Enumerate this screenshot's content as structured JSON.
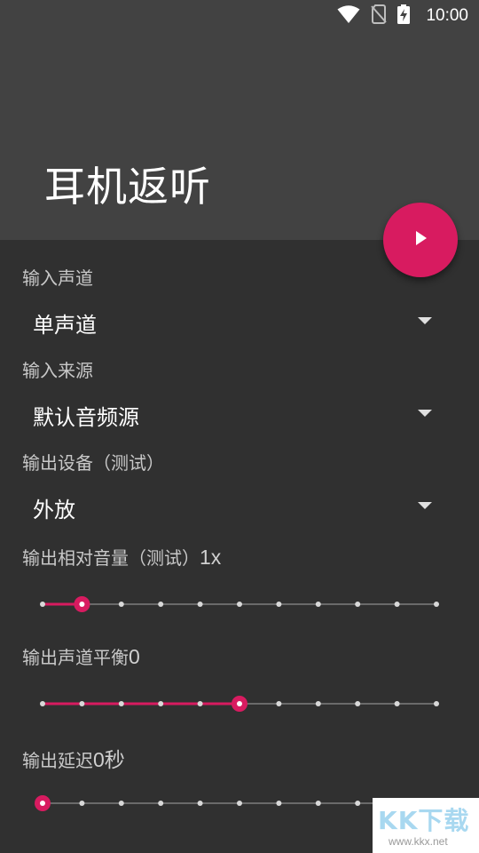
{
  "status_bar": {
    "time": "10:00",
    "icons": [
      "wifi-icon",
      "no-sim-icon",
      "battery-charging-icon"
    ]
  },
  "app": {
    "title": "耳机返听"
  },
  "fab": {
    "icon": "play-icon",
    "color": "#d81b60"
  },
  "settings": {
    "input_channel": {
      "label": "输入声道",
      "value": "单声道"
    },
    "input_source": {
      "label": "输入来源",
      "value": "默认音频源"
    },
    "output_device": {
      "label": "输出设备（测试）",
      "value": "外放"
    },
    "output_volume": {
      "label": "输出相对音量（测试）",
      "value": "1x",
      "steps": 11,
      "position": 1
    },
    "output_balance": {
      "label": "输出声道平衡",
      "value": "0",
      "steps": 11,
      "position": 5
    },
    "output_delay": {
      "label": "输出延迟",
      "value": "0秒",
      "steps": 11,
      "position": 0
    }
  },
  "watermark": {
    "logo": "KK下载",
    "url": "www.kkx.net"
  },
  "colors": {
    "accent": "#d81b60",
    "background": "#303030",
    "header": "#424242"
  }
}
